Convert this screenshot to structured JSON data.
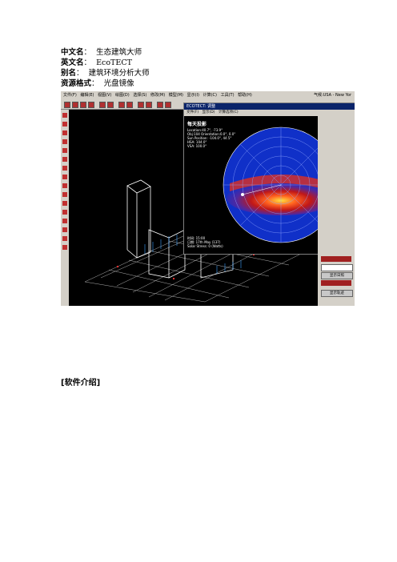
{
  "meta": [
    {
      "label": "中文名",
      "sep": "：",
      "value": "生态建筑大师"
    },
    {
      "label": "英文名",
      "sep": "：",
      "value": "EcoTECT"
    },
    {
      "label": "别名",
      "sep": "：",
      "value": "建筑环境分析大师"
    },
    {
      "label": "资源格式",
      "sep": "：",
      "value": "光盘镜像"
    }
  ],
  "intro_heading": "[软件介绍]",
  "screenshot": {
    "menu": [
      "文件(F)",
      "编辑(E)",
      "视图(V)",
      "绘图(D)",
      "选择(S)",
      "修改(M)",
      "模型(M)",
      "显示(I)",
      "计算(C)",
      "工具(T)",
      "帮助(H)"
    ],
    "location": "气候:USA - New Yor",
    "popup_title": "ECOTECT: 调整",
    "popup_menu": [
      "文件(F)",
      "显示(D)",
      "计算选项(C)"
    ],
    "popup_heading": "每天投影",
    "popup_lines": [
      "Location:40.7°, -73.9°",
      "Obj:104 Orientation:0.0°, 0.0°",
      "Sun Position: -104.0°, 44.5°",
      "HSA: 104.0°",
      "VSA: 100.0°"
    ],
    "popup_bottom": [
      "时间: 15:00",
      "日期: 17th May (137)",
      "Solar Stress: 0 (Watts)"
    ],
    "rightpanel": [
      "显示日照",
      "显示轨迹"
    ],
    "colors": {
      "bg": "#000000",
      "chrome": "#d4d0c8",
      "title": "#0a246a"
    }
  }
}
